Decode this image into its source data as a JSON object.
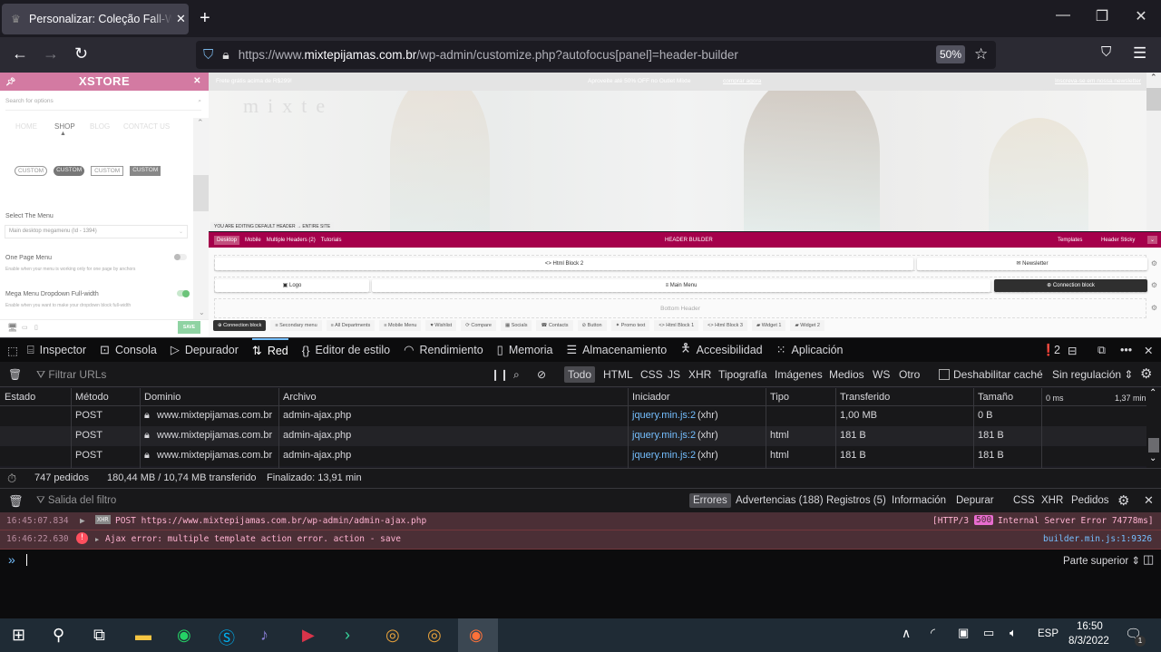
{
  "browser": {
    "tab_title": "Personalizar: Coleção Fall-Winter",
    "tab_favicon": "crown-icon",
    "new_tab": "+",
    "window_controls": {
      "minimize": "—",
      "restore": "❐",
      "close": "✕"
    },
    "url_prefix": "https://www.",
    "url_domain": "mixtepijamas.com.br",
    "url_path": "/wp-admin/customize.php?autofocus[panel]=header-builder",
    "zoom": "50%"
  },
  "customizer": {
    "brand": "XSTORE",
    "search_placeholder": "Search for options",
    "menu_preview": [
      "HOME",
      "SHOP",
      "BLOG",
      "CONTACT US"
    ],
    "custom_buttons": [
      "CUSTOM",
      "CUSTOM",
      "CUSTOM",
      "CUSTOM"
    ],
    "select_menu_label": "Select The Menu",
    "select_menu_value": "Main desktop megamenu (Id - 1394)",
    "one_page_label": "One Page Menu",
    "one_page_desc": "Enable when your menu is working only for one page by anchors",
    "one_page_on": false,
    "mega_label": "Mega Menu Dropdown Full-width",
    "mega_desc": "Enable when you want to make your dropdown block full-width",
    "mega_on": true,
    "save": "SAVE"
  },
  "preview": {
    "top_left": "Frete grátis acima de R$299!",
    "top_center": "Aproveite até 50% OFF no Outlet Mixte",
    "top_center_link": "comprar agora",
    "top_right": "Inscreva-se em nossa newsletter",
    "logo": "mixte",
    "editing_notice": "YOU ARE EDITING DEFAULT HEADER → ENTIRE SITE"
  },
  "header_builder": {
    "tabs": [
      "Desktop",
      "Mobile",
      "Multiple Headers (2)",
      "Tutorials"
    ],
    "title": "HEADER BUILDER",
    "templates": "Templates",
    "sticky": "Header Sticky",
    "top_row": [
      "<> Html Block 2",
      "✉ Newsletter"
    ],
    "main_row": [
      "▣ Logo",
      "≡ Main Menu",
      "⊕ Connection block"
    ],
    "bottom_row": "Bottom Header",
    "elements": [
      "⊕ Connection block",
      "≡ Secondary menu",
      "≡ All Departments",
      "≡ Mobile Menu",
      "♥ Wishlist",
      "⟳ Compare",
      "▦ Socials",
      "☎ Contacts",
      "⊘ Button",
      "✦ Promo text",
      "<> Html Block 1",
      "<> Html Block 3",
      "▰ Widget 1",
      "▰ Widget 2"
    ]
  },
  "devtools": {
    "tools": [
      "Inspector",
      "Consola",
      "Depurador",
      "Red",
      "Editor de estilo",
      "Rendimiento",
      "Memoria",
      "Almacenamiento",
      "Accesibilidad",
      "Aplicación"
    ],
    "selected_tool": "Red",
    "error_count": "2",
    "filter_placeholder": "Filtrar URLs",
    "type_filters": [
      "Todo",
      "HTML",
      "CSS",
      "JS",
      "XHR",
      "Tipografía",
      "Imágenes",
      "Medios",
      "WS",
      "Otro"
    ],
    "disable_cache": "Deshabilitar caché",
    "throttle": "Sin regulación ⇕",
    "columns": [
      "Estado",
      "Método",
      "Dominio",
      "Archivo",
      "Iniciador",
      "Tipo",
      "Transferido",
      "Tamaño",
      "0 ms",
      "1,37 min"
    ],
    "rows": [
      {
        "method": "POST",
        "domain": "www.mixtepijamas.com.br",
        "file": "admin-ajax.php",
        "initiator": "jquery.min.js:2",
        "initiator_suffix": "(xhr)",
        "type": "",
        "transferred": "1,00 MB",
        "size": "0 B"
      },
      {
        "method": "POST",
        "domain": "www.mixtepijamas.com.br",
        "file": "admin-ajax.php",
        "initiator": "jquery.min.js:2",
        "initiator_suffix": "(xhr)",
        "type": "html",
        "transferred": "181 B",
        "size": "181 B"
      },
      {
        "method": "POST",
        "domain": "www.mixtepijamas.com.br",
        "file": "admin-ajax.php",
        "initiator": "jquery.min.js:2",
        "initiator_suffix": "(xhr)",
        "type": "html",
        "transferred": "181 B",
        "size": "181 B"
      }
    ],
    "status_requests": "747 pedidos",
    "status_size": "180,44 MB / 10,74 MB transferido",
    "status_finished": "Finalizado: 13,91 min",
    "console_filter_placeholder": "Salida del filtro",
    "console_levels": [
      "Errores",
      "Advertencias (188)",
      "Registros (5)",
      "Información",
      "Depurar"
    ],
    "console_extra": [
      "CSS",
      "XHR",
      "Pedidos"
    ],
    "messages": [
      {
        "time": "16:45:07.834",
        "badge": "XHR",
        "text": "POST https://www.mixtepijamas.com.br/wp-admin/admin-ajax.php",
        "right_pre": "[HTTP/3",
        "status": "500",
        "right_post": "Internal Server Error 74778ms]"
      },
      {
        "time": "16:46:22.630",
        "text": "Ajax error: multiple template action error. action - save",
        "source": "builder.min.js:1:9326"
      }
    ],
    "context": "Parte superior ⇕",
    "prompt": "»"
  },
  "taskbar": {
    "lang": "ESP",
    "time": "16:50",
    "date": "8/3/2022",
    "notifications": "1"
  }
}
